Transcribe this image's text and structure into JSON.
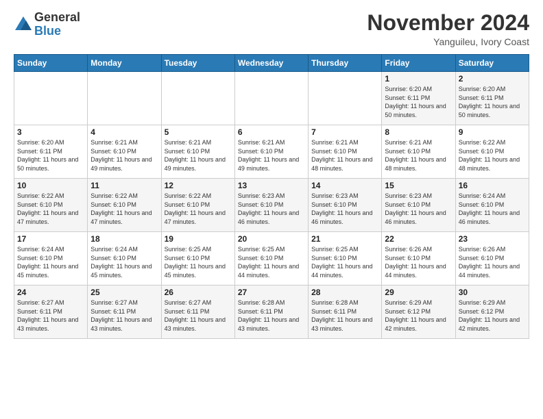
{
  "header": {
    "logo_general": "General",
    "logo_blue": "Blue",
    "month_title": "November 2024",
    "location": "Yanguileu, Ivory Coast"
  },
  "days_of_week": [
    "Sunday",
    "Monday",
    "Tuesday",
    "Wednesday",
    "Thursday",
    "Friday",
    "Saturday"
  ],
  "weeks": [
    [
      {
        "day": "",
        "info": ""
      },
      {
        "day": "",
        "info": ""
      },
      {
        "day": "",
        "info": ""
      },
      {
        "day": "",
        "info": ""
      },
      {
        "day": "",
        "info": ""
      },
      {
        "day": "1",
        "info": "Sunrise: 6:20 AM\nSunset: 6:11 PM\nDaylight: 11 hours\nand 50 minutes."
      },
      {
        "day": "2",
        "info": "Sunrise: 6:20 AM\nSunset: 6:11 PM\nDaylight: 11 hours\nand 50 minutes."
      }
    ],
    [
      {
        "day": "3",
        "info": "Sunrise: 6:20 AM\nSunset: 6:11 PM\nDaylight: 11 hours\nand 50 minutes."
      },
      {
        "day": "4",
        "info": "Sunrise: 6:21 AM\nSunset: 6:10 PM\nDaylight: 11 hours\nand 49 minutes."
      },
      {
        "day": "5",
        "info": "Sunrise: 6:21 AM\nSunset: 6:10 PM\nDaylight: 11 hours\nand 49 minutes."
      },
      {
        "day": "6",
        "info": "Sunrise: 6:21 AM\nSunset: 6:10 PM\nDaylight: 11 hours\nand 49 minutes."
      },
      {
        "day": "7",
        "info": "Sunrise: 6:21 AM\nSunset: 6:10 PM\nDaylight: 11 hours\nand 48 minutes."
      },
      {
        "day": "8",
        "info": "Sunrise: 6:21 AM\nSunset: 6:10 PM\nDaylight: 11 hours\nand 48 minutes."
      },
      {
        "day": "9",
        "info": "Sunrise: 6:22 AM\nSunset: 6:10 PM\nDaylight: 11 hours\nand 48 minutes."
      }
    ],
    [
      {
        "day": "10",
        "info": "Sunrise: 6:22 AM\nSunset: 6:10 PM\nDaylight: 11 hours\nand 47 minutes."
      },
      {
        "day": "11",
        "info": "Sunrise: 6:22 AM\nSunset: 6:10 PM\nDaylight: 11 hours\nand 47 minutes."
      },
      {
        "day": "12",
        "info": "Sunrise: 6:22 AM\nSunset: 6:10 PM\nDaylight: 11 hours\nand 47 minutes."
      },
      {
        "day": "13",
        "info": "Sunrise: 6:23 AM\nSunset: 6:10 PM\nDaylight: 11 hours\nand 46 minutes."
      },
      {
        "day": "14",
        "info": "Sunrise: 6:23 AM\nSunset: 6:10 PM\nDaylight: 11 hours\nand 46 minutes."
      },
      {
        "day": "15",
        "info": "Sunrise: 6:23 AM\nSunset: 6:10 PM\nDaylight: 11 hours\nand 46 minutes."
      },
      {
        "day": "16",
        "info": "Sunrise: 6:24 AM\nSunset: 6:10 PM\nDaylight: 11 hours\nand 46 minutes."
      }
    ],
    [
      {
        "day": "17",
        "info": "Sunrise: 6:24 AM\nSunset: 6:10 PM\nDaylight: 11 hours\nand 45 minutes."
      },
      {
        "day": "18",
        "info": "Sunrise: 6:24 AM\nSunset: 6:10 PM\nDaylight: 11 hours\nand 45 minutes."
      },
      {
        "day": "19",
        "info": "Sunrise: 6:25 AM\nSunset: 6:10 PM\nDaylight: 11 hours\nand 45 minutes."
      },
      {
        "day": "20",
        "info": "Sunrise: 6:25 AM\nSunset: 6:10 PM\nDaylight: 11 hours\nand 44 minutes."
      },
      {
        "day": "21",
        "info": "Sunrise: 6:25 AM\nSunset: 6:10 PM\nDaylight: 11 hours\nand 44 minutes."
      },
      {
        "day": "22",
        "info": "Sunrise: 6:26 AM\nSunset: 6:10 PM\nDaylight: 11 hours\nand 44 minutes."
      },
      {
        "day": "23",
        "info": "Sunrise: 6:26 AM\nSunset: 6:10 PM\nDaylight: 11 hours\nand 44 minutes."
      }
    ],
    [
      {
        "day": "24",
        "info": "Sunrise: 6:27 AM\nSunset: 6:11 PM\nDaylight: 11 hours\nand 43 minutes."
      },
      {
        "day": "25",
        "info": "Sunrise: 6:27 AM\nSunset: 6:11 PM\nDaylight: 11 hours\nand 43 minutes."
      },
      {
        "day": "26",
        "info": "Sunrise: 6:27 AM\nSunset: 6:11 PM\nDaylight: 11 hours\nand 43 minutes."
      },
      {
        "day": "27",
        "info": "Sunrise: 6:28 AM\nSunset: 6:11 PM\nDaylight: 11 hours\nand 43 minutes."
      },
      {
        "day": "28",
        "info": "Sunrise: 6:28 AM\nSunset: 6:11 PM\nDaylight: 11 hours\nand 43 minutes."
      },
      {
        "day": "29",
        "info": "Sunrise: 6:29 AM\nSunset: 6:12 PM\nDaylight: 11 hours\nand 42 minutes."
      },
      {
        "day": "30",
        "info": "Sunrise: 6:29 AM\nSunset: 6:12 PM\nDaylight: 11 hours\nand 42 minutes."
      }
    ]
  ]
}
